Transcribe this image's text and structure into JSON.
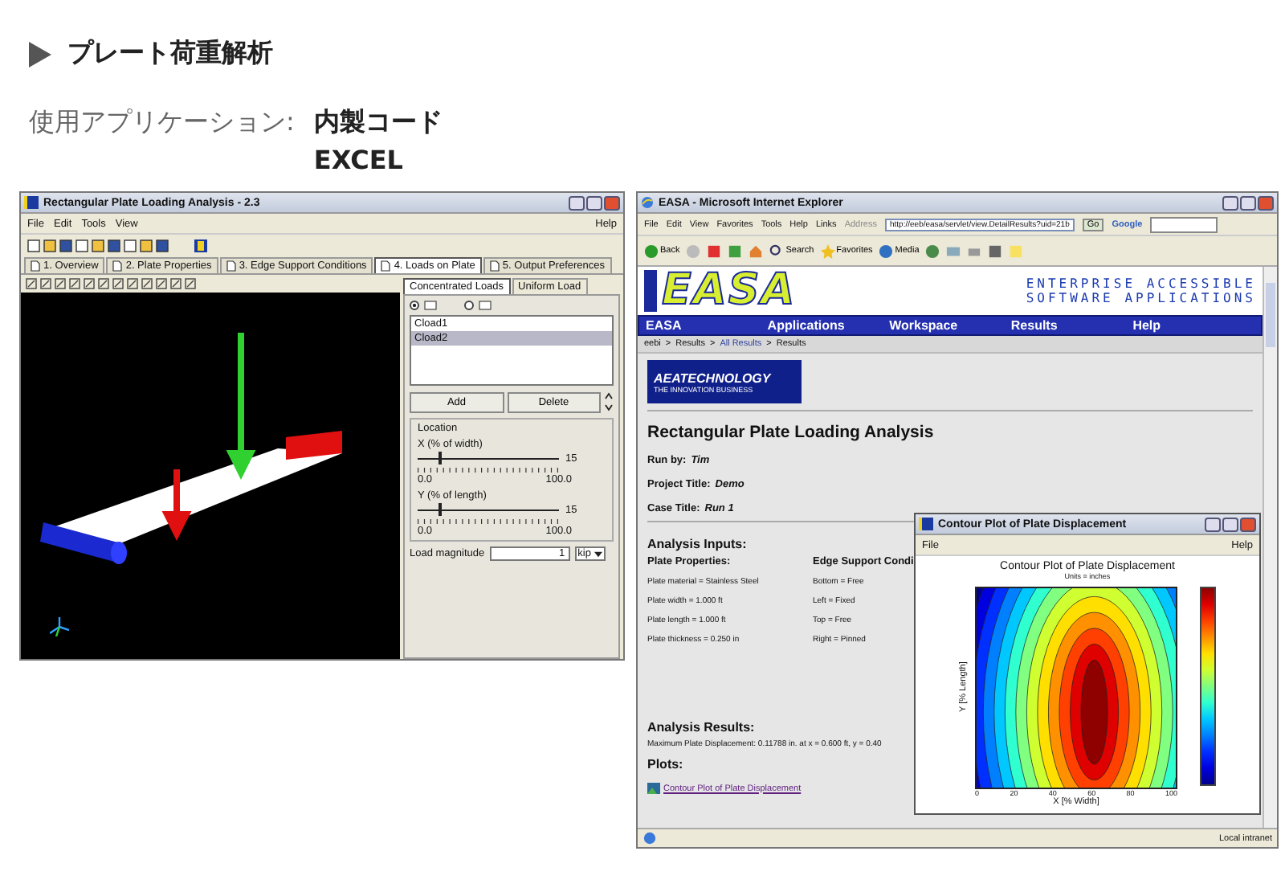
{
  "heading": {
    "title": "プレート荷重解析"
  },
  "info": {
    "label": "使用アプリケーション:",
    "values": [
      "内製コード",
      "EXCEL"
    ]
  },
  "app_window": {
    "title": "Rectangular Plate Loading Analysis - 2.3",
    "menu": [
      "File",
      "Edit",
      "Tools",
      "View"
    ],
    "help": "Help",
    "tabs": [
      {
        "label": "1. Overview",
        "selected": false
      },
      {
        "label": "2. Plate Properties",
        "selected": false
      },
      {
        "label": "3. Edge Support Conditions",
        "selected": false
      },
      {
        "label": "4. Loads on Plate",
        "selected": true
      },
      {
        "label": "5. Output Preferences",
        "selected": false
      }
    ],
    "panel_tabs": [
      {
        "label": "Concentrated Loads",
        "selected": true
      },
      {
        "label": "Uniform Load",
        "selected": false
      }
    ],
    "view_options": [
      {
        "selected": true
      },
      {
        "selected": false
      }
    ],
    "loads": [
      {
        "label": "Cload1",
        "selected": false
      },
      {
        "label": "Cload2",
        "selected": true
      }
    ],
    "buttons": [
      "Add",
      "Delete"
    ],
    "location": {
      "title": "Location",
      "sliders": [
        {
          "label": "X (% of width)",
          "min": "0.0",
          "max": "100.0",
          "value": "15",
          "level": 0.15
        },
        {
          "label": "Y (% of length)",
          "min": "0.0",
          "max": "100.0",
          "value": "15",
          "level": 0.15
        }
      ]
    },
    "load_magnitude": {
      "label": "Load magnitude",
      "value": "1",
      "unit": "kip"
    }
  },
  "browser": {
    "title": "EASA - Microsoft Internet Explorer",
    "menu": [
      "File",
      "Edit",
      "View",
      "Favorites",
      "Tools",
      "Help"
    ],
    "links": "Links",
    "address_label": "Address",
    "address": "http://eeb/easa/servlet/view.DetailResults?uid=21b",
    "go": "Go",
    "search_engine": "Google",
    "toolbar": [
      "Back",
      "Search",
      "Favorites",
      "Media"
    ],
    "banner": {
      "logo": "EASA",
      "tagline": [
        "ENTERPRISE ACCESSIBLE",
        "SOFTWARE APPLICATIONS"
      ]
    },
    "nav": [
      "EASA",
      "Applications",
      "Workspace",
      "Results",
      "Help"
    ],
    "breadcrumb": [
      {
        "label": "eebi",
        "link": false,
        "separator": ">"
      },
      {
        "label": "Results",
        "link": false,
        "separator": ">"
      },
      {
        "label": "All Results",
        "link": true,
        "separator": ">"
      },
      {
        "label": "Results",
        "link": false
      }
    ],
    "company_logo": {
      "name": "AEATECHNOLOGY",
      "tagline": "THE INNOVATION BUSINESS"
    },
    "page": {
      "title": "Rectangular Plate Loading Analysis",
      "meta": [
        {
          "label": "Run by:",
          "value": "Tim"
        },
        {
          "label": "Project Title:",
          "value": "Demo"
        },
        {
          "label": "Case Title:",
          "value": "Run 1"
        }
      ],
      "inputs_title": "Analysis Inputs:",
      "input_columns": [
        {
          "heading": "Plate Properties:",
          "lines": [
            "Plate material = Stainless Steel",
            "Plate width = 1.000 ft",
            "Plate length = 1.000 ft",
            "Plate thickness = 0.250 in"
          ]
        },
        {
          "heading": "Edge Support Condi",
          "lines": [
            "Bottom = Free",
            "Left = Fixed",
            "Top = Free",
            "Right = Pinned"
          ]
        }
      ],
      "results_title": "Analysis Results:",
      "result": "Maximum Plate Displacement: 0.11788 in. at x = 0.600 ft, y = 0.40",
      "plots_title": "Plots:",
      "plot_link": "Contour Plot of Plate Displacement"
    },
    "status": "Local intranet"
  },
  "plot_window": {
    "title": "Contour Plot of Plate Displacement",
    "menu": [
      "File"
    ],
    "help": "Help",
    "plot_title": "Contour Plot of Plate Displacement",
    "subtitle": "Units = inches",
    "xlabel": "X [% Width]",
    "ylabel": "Y [% Length]",
    "xticks": [
      "0",
      "20",
      "40",
      "60",
      "80",
      "100"
    ]
  }
}
